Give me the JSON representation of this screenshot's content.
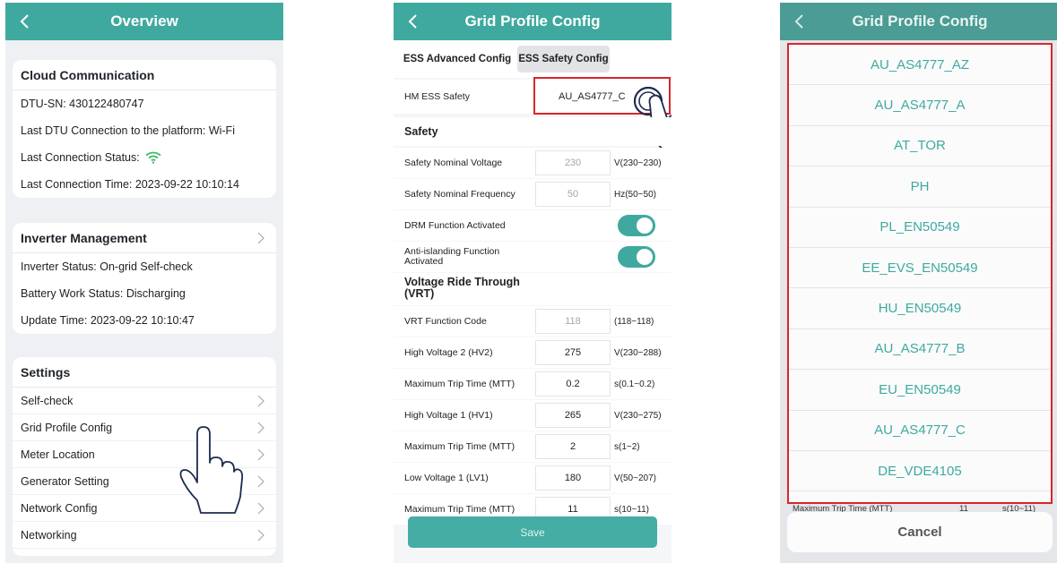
{
  "colors": {
    "accent": "#3fa99f",
    "highlight": "#d9262c"
  },
  "overview": {
    "title": "Overview",
    "cloud": {
      "title": "Cloud Communication",
      "rows": [
        "DTU-SN:  430122480747",
        "Last DTU Connection to the platform:  Wi-Fi",
        "Last Connection Status:",
        "Last Connection Time:  2023-09-22 10:10:14"
      ]
    },
    "inverter": {
      "title": "Inverter Management",
      "rows": [
        "Inverter Status:  On-grid Self-check",
        "Battery Work Status:  Discharging",
        "Update Time:  2023-09-22 10:10:47"
      ]
    },
    "settings": {
      "title": "Settings",
      "items": [
        "Self-check",
        "Grid Profile Config",
        "Meter Location",
        "Generator Setting",
        "Network Config",
        "Networking"
      ]
    }
  },
  "config": {
    "title": "Grid Profile Config",
    "tabs": [
      "ESS Advanced Config",
      "ESS Safety Config"
    ],
    "hm_label": "HM ESS Safety",
    "hm_value": "AU_AS4777_C",
    "safety_title": "Safety",
    "nominal_voltage": {
      "label": "Safety Nominal Voltage",
      "value": "230",
      "range": "V(230~230)"
    },
    "nominal_frequency": {
      "label": "Safety Nominal Frequency",
      "value": "50",
      "range": "Hz(50~50)"
    },
    "drm": {
      "label": "DRM Function Activated",
      "on": true
    },
    "anti": {
      "label": "Anti-islanding Function Activated",
      "on": true
    },
    "vrt_title": "Voltage Ride Through (VRT)",
    "vrt_code": {
      "label": "VRT Function Code",
      "value": "118",
      "range": "(118~118)"
    },
    "hv2": {
      "label": "High Voltage 2 (HV2)",
      "value": "275",
      "range": "V(230~288)"
    },
    "mtt1": {
      "label": "Maximum Trip Time (MTT)",
      "value": "0.2",
      "range": "s(0.1~0.2)"
    },
    "hv1": {
      "label": "High Voltage 1 (HV1)",
      "value": "265",
      "range": "V(230~275)"
    },
    "mtt2": {
      "label": "Maximum Trip Time (MTT)",
      "value": "2",
      "range": "s(1~2)"
    },
    "lv1": {
      "label": "Low Voltage 1 (LV1)",
      "value": "180",
      "range": "V(50~207)"
    },
    "mtt3": {
      "label": "Maximum Trip Time (MTT)",
      "value": "11",
      "range": "s(10~11)"
    },
    "save": "Save"
  },
  "picker": {
    "title": "Grid Profile Config",
    "options": [
      "AU_AS4777_AZ",
      "AU_AS4777_A",
      "AT_TOR",
      "PH",
      "PL_EN50549",
      "EE_EVS_EN50549",
      "HU_EN50549",
      "AU_AS4777_B",
      "EU_EN50549",
      "AU_AS4777_C",
      "DE_VDE4105"
    ],
    "peek_label": "Maximum Trip Time (MTT)",
    "peek_value": "11",
    "peek_range": "s(10~11)",
    "cancel": "Cancel"
  }
}
